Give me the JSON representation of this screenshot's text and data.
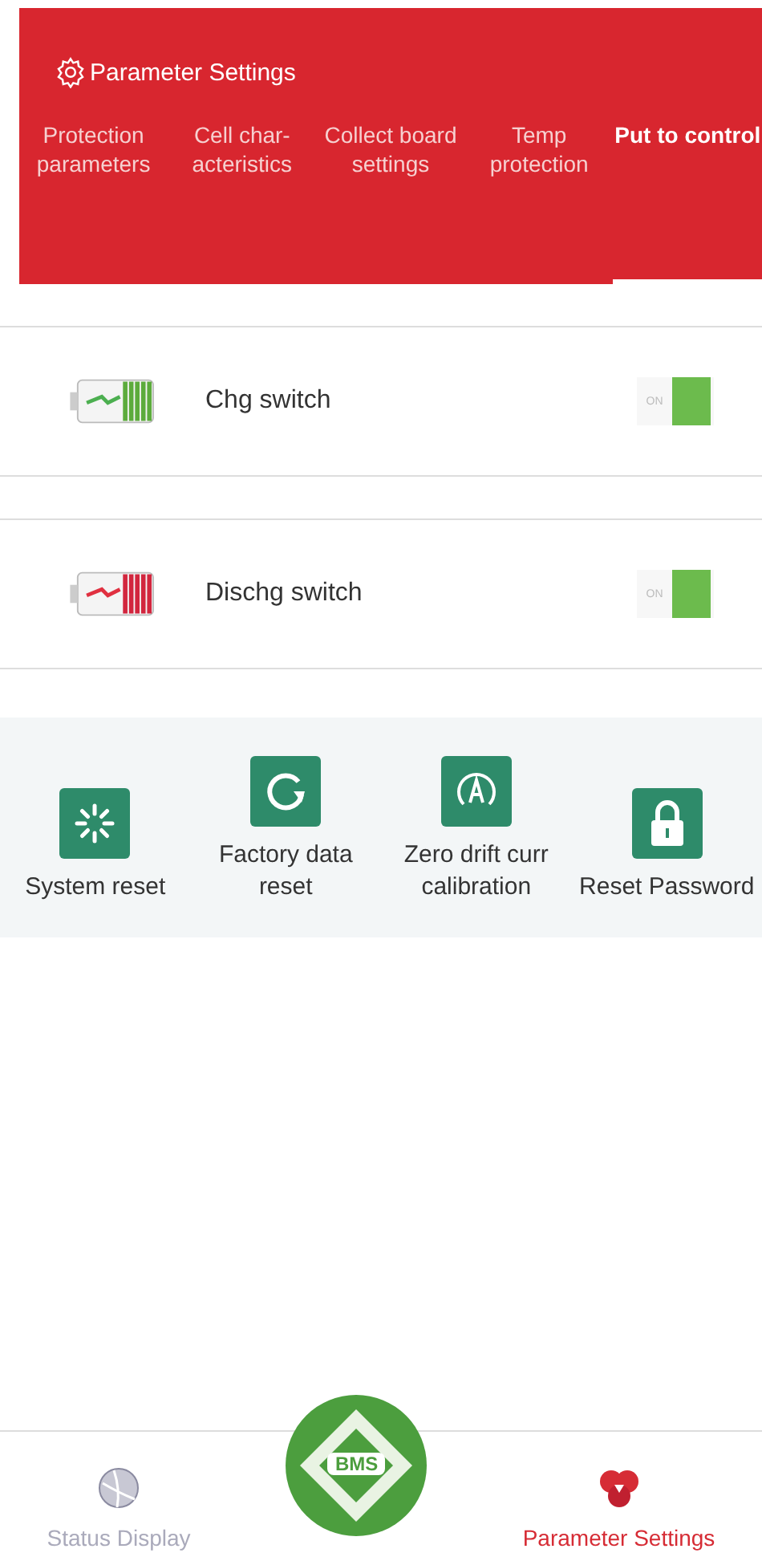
{
  "header": {
    "title": "Parameter Settings"
  },
  "tabs": [
    {
      "label": "Protection parameters",
      "selected": false
    },
    {
      "label": "Cell char-acteristics",
      "selected": false
    },
    {
      "label": "Collect board settings",
      "selected": false
    },
    {
      "label": "Temp protection",
      "selected": false
    },
    {
      "label": "Put to control",
      "selected": true
    }
  ],
  "switches": [
    {
      "label": "Chg switch",
      "kind": "charge",
      "on": true,
      "toggle_text": "ON"
    },
    {
      "label": "Dischg switch",
      "kind": "discharge",
      "on": true,
      "toggle_text": "ON"
    }
  ],
  "actions": [
    {
      "label": "System reset",
      "kind": "spinner"
    },
    {
      "label": "Factory data reset",
      "kind": "refresh"
    },
    {
      "label": "Zero drift curr calibration",
      "kind": "auto"
    },
    {
      "label": "Reset Password",
      "kind": "lock"
    }
  ],
  "bottom_nav": {
    "logo_text": "BMS",
    "items": [
      {
        "label": "Status Display",
        "selected": false
      },
      {
        "label": "Parameter Settings",
        "selected": true
      }
    ]
  }
}
